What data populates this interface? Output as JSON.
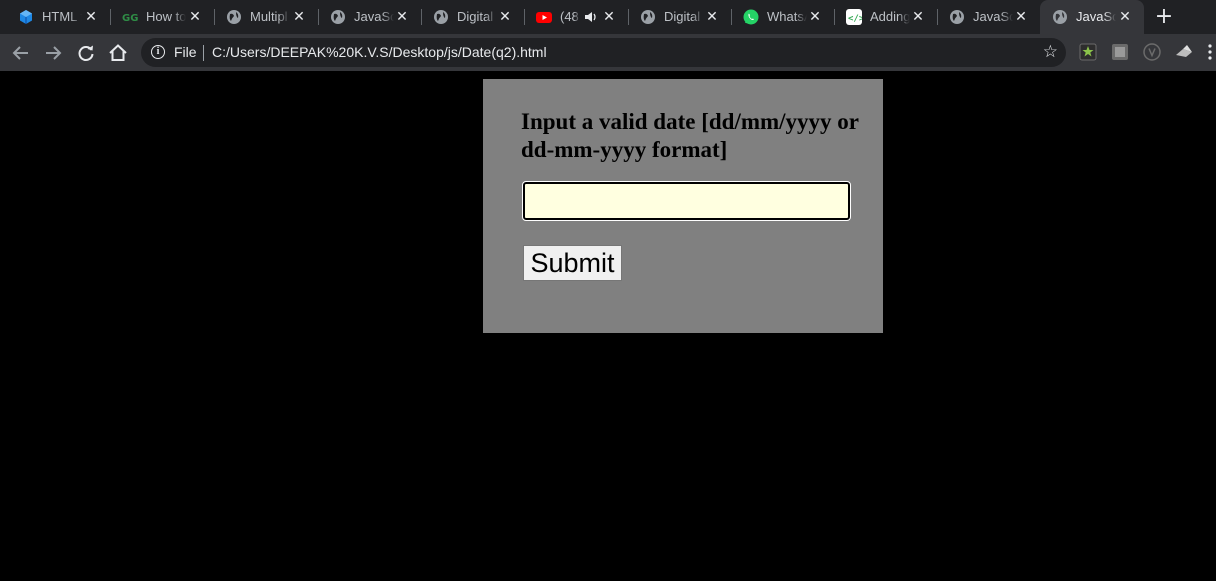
{
  "tabs": [
    {
      "title": "HTML f",
      "icon": "codepen-cube-icon"
    },
    {
      "title": "How to",
      "icon": "gfg-icon"
    },
    {
      "title": "Multipl",
      "icon": "globe-icon"
    },
    {
      "title": "JavaScr",
      "icon": "globe-icon"
    },
    {
      "title": "Digital",
      "icon": "globe-icon"
    },
    {
      "title": "(48",
      "icon": "youtube-icon",
      "audio": true
    },
    {
      "title": "Digital",
      "icon": "globe-icon"
    },
    {
      "title": "WhatsA",
      "icon": "whatsapp-icon"
    },
    {
      "title": "Adding",
      "icon": "code-icon"
    },
    {
      "title": "JavaScr",
      "icon": "globe-icon"
    },
    {
      "title": "JavaScr",
      "icon": "globe-icon",
      "active": true
    }
  ],
  "address_bar": {
    "scheme_label": "File",
    "url": "C:/Users/DEEPAK%20K.V.S/Desktop/js/Date(q2).html"
  },
  "page": {
    "heading": "Input a valid date [dd/mm/yyyy or dd-mm-yyyy format]",
    "date_input_value": "",
    "submit_label": "Submit"
  },
  "colors": {
    "page_background": "#000000",
    "card_background": "#808080",
    "input_background": "#ffffe0"
  }
}
